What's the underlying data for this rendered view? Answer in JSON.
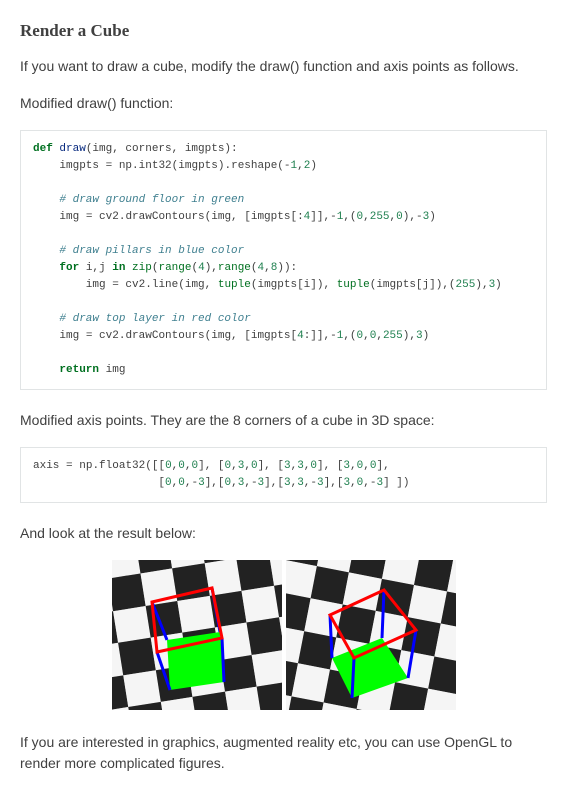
{
  "heading": "Render a Cube",
  "intro": "If you want to draw a cube, modify the draw() function and axis points as follows.",
  "label_draw": "Modified draw() function:",
  "code_draw": {
    "tokens": [
      {
        "t": "def ",
        "c": "k"
      },
      {
        "t": "draw",
        "c": "nf"
      },
      {
        "t": "(img, corners, imgpts):\n"
      },
      {
        "t": "    imgpts "
      },
      {
        "t": "=",
        "c": ""
      },
      {
        "t": " np"
      },
      {
        "t": "."
      },
      {
        "t": "int32(imgpts)"
      },
      {
        "t": "."
      },
      {
        "t": "reshape("
      },
      {
        "t": "-",
        "c": ""
      },
      {
        "t": "1",
        "c": "mi"
      },
      {
        "t": ","
      },
      {
        "t": "2",
        "c": "mi"
      },
      {
        "t": ")\n\n"
      },
      {
        "t": "    "
      },
      {
        "t": "# draw ground floor in green",
        "c": "c1"
      },
      {
        "t": "\n"
      },
      {
        "t": "    img "
      },
      {
        "t": "="
      },
      {
        "t": " cv2"
      },
      {
        "t": "."
      },
      {
        "t": "drawContours(img, [imgpts[:"
      },
      {
        "t": "4",
        "c": "mi"
      },
      {
        "t": "]],"
      },
      {
        "t": "-"
      },
      {
        "t": "1",
        "c": "mi"
      },
      {
        "t": ",("
      },
      {
        "t": "0",
        "c": "mi"
      },
      {
        "t": ","
      },
      {
        "t": "255",
        "c": "mi"
      },
      {
        "t": ","
      },
      {
        "t": "0",
        "c": "mi"
      },
      {
        "t": "),"
      },
      {
        "t": "-"
      },
      {
        "t": "3",
        "c": "mi"
      },
      {
        "t": ")\n\n"
      },
      {
        "t": "    "
      },
      {
        "t": "# draw pillars in blue color",
        "c": "c1"
      },
      {
        "t": "\n"
      },
      {
        "t": "    "
      },
      {
        "t": "for",
        "c": "k"
      },
      {
        "t": " i,j "
      },
      {
        "t": "in",
        "c": "k"
      },
      {
        "t": " "
      },
      {
        "t": "zip",
        "c": "nb"
      },
      {
        "t": "("
      },
      {
        "t": "range",
        "c": "nb"
      },
      {
        "t": "("
      },
      {
        "t": "4",
        "c": "mi"
      },
      {
        "t": "),"
      },
      {
        "t": "range",
        "c": "nb"
      },
      {
        "t": "("
      },
      {
        "t": "4",
        "c": "mi"
      },
      {
        "t": ","
      },
      {
        "t": "8",
        "c": "mi"
      },
      {
        "t": ")):\n"
      },
      {
        "t": "        img "
      },
      {
        "t": "="
      },
      {
        "t": " cv2"
      },
      {
        "t": "."
      },
      {
        "t": "line(img, "
      },
      {
        "t": "tuple",
        "c": "nb"
      },
      {
        "t": "(imgpts[i]), "
      },
      {
        "t": "tuple",
        "c": "nb"
      },
      {
        "t": "(imgpts[j]),("
      },
      {
        "t": "255",
        "c": "mi"
      },
      {
        "t": "),"
      },
      {
        "t": "3",
        "c": "mi"
      },
      {
        "t": ")\n\n"
      },
      {
        "t": "    "
      },
      {
        "t": "# draw top layer in red color",
        "c": "c1"
      },
      {
        "t": "\n"
      },
      {
        "t": "    img "
      },
      {
        "t": "="
      },
      {
        "t": " cv2"
      },
      {
        "t": "."
      },
      {
        "t": "drawContours(img, [imgpts["
      },
      {
        "t": "4",
        "c": "mi"
      },
      {
        "t": ":]],"
      },
      {
        "t": "-"
      },
      {
        "t": "1",
        "c": "mi"
      },
      {
        "t": ",("
      },
      {
        "t": "0",
        "c": "mi"
      },
      {
        "t": ","
      },
      {
        "t": "0",
        "c": "mi"
      },
      {
        "t": ","
      },
      {
        "t": "255",
        "c": "mi"
      },
      {
        "t": "),"
      },
      {
        "t": "3",
        "c": "mi"
      },
      {
        "t": ")\n\n"
      },
      {
        "t": "    "
      },
      {
        "t": "return",
        "c": "k"
      },
      {
        "t": " img"
      }
    ]
  },
  "label_axis": "Modified axis points. They are the 8 corners of a cube in 3D space:",
  "code_axis": {
    "tokens": [
      {
        "t": "axis "
      },
      {
        "t": "="
      },
      {
        "t": " np"
      },
      {
        "t": "."
      },
      {
        "t": "float32([["
      },
      {
        "t": "0",
        "c": "mi"
      },
      {
        "t": ","
      },
      {
        "t": "0",
        "c": "mi"
      },
      {
        "t": ","
      },
      {
        "t": "0",
        "c": "mi"
      },
      {
        "t": "], ["
      },
      {
        "t": "0",
        "c": "mi"
      },
      {
        "t": ","
      },
      {
        "t": "3",
        "c": "mi"
      },
      {
        "t": ","
      },
      {
        "t": "0",
        "c": "mi"
      },
      {
        "t": "], ["
      },
      {
        "t": "3",
        "c": "mi"
      },
      {
        "t": ","
      },
      {
        "t": "3",
        "c": "mi"
      },
      {
        "t": ","
      },
      {
        "t": "0",
        "c": "mi"
      },
      {
        "t": "], ["
      },
      {
        "t": "3",
        "c": "mi"
      },
      {
        "t": ","
      },
      {
        "t": "0",
        "c": "mi"
      },
      {
        "t": ","
      },
      {
        "t": "0",
        "c": "mi"
      },
      {
        "t": "],\n"
      },
      {
        "t": "                   ["
      },
      {
        "t": "0",
        "c": "mi"
      },
      {
        "t": ","
      },
      {
        "t": "0",
        "c": "mi"
      },
      {
        "t": ","
      },
      {
        "t": "-"
      },
      {
        "t": "3",
        "c": "mi"
      },
      {
        "t": "],["
      },
      {
        "t": "0",
        "c": "mi"
      },
      {
        "t": ","
      },
      {
        "t": "3",
        "c": "mi"
      },
      {
        "t": ","
      },
      {
        "t": "-"
      },
      {
        "t": "3",
        "c": "mi"
      },
      {
        "t": "],["
      },
      {
        "t": "3",
        "c": "mi"
      },
      {
        "t": ","
      },
      {
        "t": "3",
        "c": "mi"
      },
      {
        "t": ","
      },
      {
        "t": "-"
      },
      {
        "t": "3",
        "c": "mi"
      },
      {
        "t": "],["
      },
      {
        "t": "3",
        "c": "mi"
      },
      {
        "t": ","
      },
      {
        "t": "0",
        "c": "mi"
      },
      {
        "t": ","
      },
      {
        "t": "-"
      },
      {
        "t": "3",
        "c": "mi"
      },
      {
        "t": "] ])"
      }
    ]
  },
  "label_result": "And look at the result below:",
  "outro": "If you are interested in graphics, augmented reality etc, you can use OpenGL to render more complicated figures.",
  "cube_colors": {
    "floor": "#00ff00",
    "pillar": "#0000ff",
    "top": "#ff0000"
  }
}
